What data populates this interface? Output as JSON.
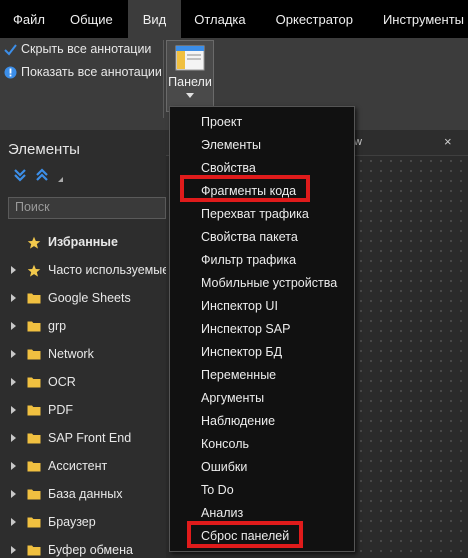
{
  "menubar": {
    "items": [
      "Файл",
      "Общие",
      "Вид",
      "Отладка",
      "Оркестратор",
      "Инструменты"
    ],
    "active_index": 2
  },
  "ribbon": {
    "hide_annotations": "Скрыть все аннотации",
    "show_annotations": "Показать все аннотации",
    "panels_label": "Панели"
  },
  "left_panel": {
    "title": "Элементы",
    "search_placeholder": "Поиск",
    "tree": [
      {
        "label": "Избранные",
        "icon": "star-icon",
        "expandable": false
      },
      {
        "label": "Часто используемые",
        "icon": "star-icon",
        "expandable": true
      },
      {
        "label": "Google Sheets",
        "icon": "folder-icon",
        "expandable": true
      },
      {
        "label": "grp",
        "icon": "folder-icon",
        "expandable": true
      },
      {
        "label": "Network",
        "icon": "folder-icon",
        "expandable": true
      },
      {
        "label": "OCR",
        "icon": "folder-icon",
        "expandable": true
      },
      {
        "label": "PDF",
        "icon": "folder-icon",
        "expandable": true
      },
      {
        "label": "SAP Front End",
        "icon": "folder-icon",
        "expandable": true
      },
      {
        "label": "Ассистент",
        "icon": "folder-icon",
        "expandable": true
      },
      {
        "label": "База данных",
        "icon": "folder-icon",
        "expandable": true
      },
      {
        "label": "Браузер",
        "icon": "folder-icon",
        "expandable": true
      },
      {
        "label": "Буфер обмена",
        "icon": "folder-icon",
        "expandable": true
      }
    ]
  },
  "designer": {
    "tab_fragment": "w",
    "close_glyph": "×"
  },
  "panels_menu": {
    "items": [
      "Проект",
      "Элементы",
      "Свойства",
      "Фрагменты кода",
      "Перехват трафика",
      "Свойства пакета",
      "Фильтр трафика",
      "Мобильные устройства",
      "Инспектор UI",
      "Инспектор SAP",
      "Инспектор БД",
      "Переменные",
      "Аргументы",
      "Наблюдение",
      "Консоль",
      "Ошибки",
      "To Do",
      "Анализ",
      "Сброс панелей"
    ],
    "highlighted": [
      "Фрагменты кода",
      "Сброс панелей"
    ]
  },
  "colors": {
    "highlight": "#e01b1b",
    "star": "#f2c94c",
    "folder": "#f0c040",
    "accent_blue": "#3c8ee8"
  }
}
